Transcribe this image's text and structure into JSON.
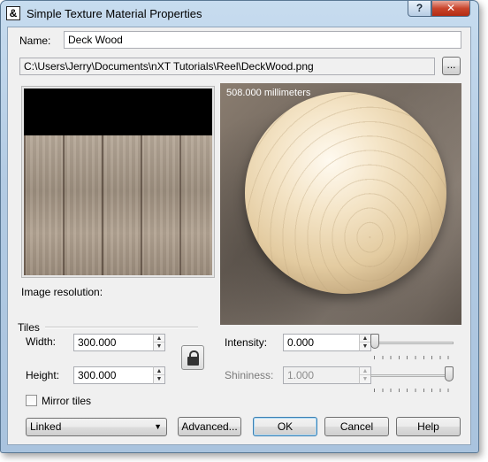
{
  "window": {
    "title": "Simple Texture Material Properties",
    "help_label": "?",
    "close_label": "✕"
  },
  "name": {
    "label": "Name:",
    "value": "Deck Wood"
  },
  "file": {
    "path": "C:\\Users\\Jerry\\Documents\\nXT Tutorials\\Reel\\DeckWood.png",
    "browse_label": "..."
  },
  "preview": {
    "size_label": "508.000 millimeters"
  },
  "image_resolution": {
    "label": "Image resolution:"
  },
  "tiles": {
    "group_label": "Tiles",
    "width_label": "Width:",
    "width_value": "300.000",
    "height_label": "Height:",
    "height_value": "300.000",
    "mirror_label": "Mirror tiles",
    "mirror_checked": false
  },
  "lighting": {
    "intensity_label": "Intensity:",
    "intensity_value": "0.000",
    "intensity_slider": 0.0,
    "shininess_label": "Shininess:",
    "shininess_value": "1.000",
    "shininess_slider": 1.0
  },
  "link_mode": {
    "selected": "Linked"
  },
  "buttons": {
    "advanced": "Advanced...",
    "ok": "OK",
    "cancel": "Cancel",
    "help": "Help"
  },
  "icons": {
    "app": "material-app-icon",
    "lock": "lock-icon",
    "spin_up": "▲",
    "spin_down": "▼",
    "combo_arrow": "▼"
  }
}
